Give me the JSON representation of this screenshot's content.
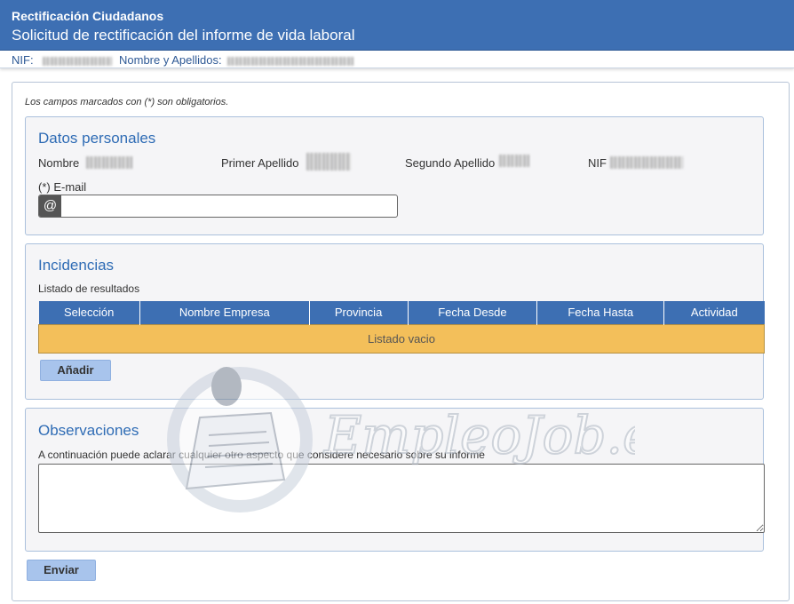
{
  "header": {
    "app_title": "Rectificación Ciudadanos",
    "subtitle": "Solicitud de rectificación del informe de vida laboral"
  },
  "idbar": {
    "nif_label": "NIF:",
    "name_label": "Nombre y Apellidos:"
  },
  "form": {
    "required_note": "Los campos marcados con (*) son obligatorios."
  },
  "personal": {
    "title": "Datos personales",
    "nombre_label": "Nombre",
    "apellido1_label": "Primer Apellido",
    "apellido2_label": "Segundo Apellido",
    "nif_label": "NIF",
    "email_label": "(*) E-mail",
    "email_icon": "@",
    "email_value": ""
  },
  "incidencias": {
    "title": "Incidencias",
    "list_label": "Listado de resultados",
    "columns": [
      "Selección",
      "Nombre Empresa",
      "Provincia",
      "Fecha Desde",
      "Fecha Hasta",
      "Actividad"
    ],
    "empty_text": "Listado vacio",
    "add_button": "Añadir"
  },
  "observaciones": {
    "title": "Observaciones",
    "hint": "A continuación puede aclarar cualquier otro aspecto que considere necesario sobre su informe",
    "value": ""
  },
  "actions": {
    "submit_button": "Enviar"
  },
  "watermark": {
    "text": "EmpleoJob.es",
    "icon": "newspaper-reader-icon"
  },
  "colors": {
    "header_bg": "#3d6fb3",
    "panel_title": "#2f6cb5",
    "empty_row": "#f3bf5a",
    "button_bg": "#a8c4ec"
  }
}
